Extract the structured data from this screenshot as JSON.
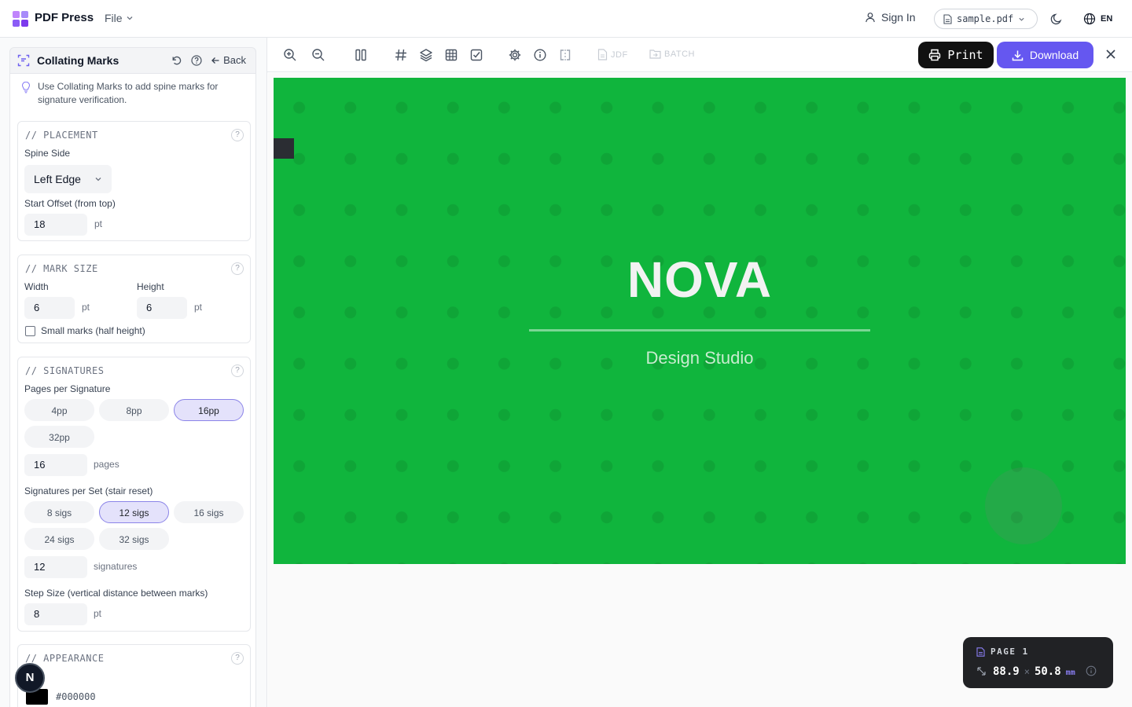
{
  "header": {
    "brand": "PDF Press",
    "file_menu": "File",
    "sign_in": "Sign In",
    "file_name": "sample.pdf",
    "language": "EN",
    "logo_colors": [
      "#a78bfa",
      "#7c3aed",
      "#c084fc",
      "#8b5cf6"
    ]
  },
  "panel": {
    "title": "Collating Marks",
    "back_label": "Back",
    "tip": "Use Collating Marks to add spine marks for signature verification."
  },
  "placement": {
    "section_title": "// PLACEMENT",
    "spine_side_label": "Spine Side",
    "spine_side_value": "Left Edge",
    "start_offset_label": "Start Offset (from top)",
    "start_offset_value": "18",
    "start_offset_unit": "pt"
  },
  "mark_size": {
    "section_title": "// MARK SIZE",
    "width_label": "Width",
    "width_value": "6",
    "width_unit": "pt",
    "height_label": "Height",
    "height_value": "6",
    "height_unit": "pt",
    "small_marks_label": "Small marks (half height)",
    "small_marks_checked": false
  },
  "signatures": {
    "section_title": "// SIGNATURES",
    "pages_per_signature_label": "Pages per Signature",
    "pages_options": [
      "4pp",
      "8pp",
      "16pp",
      "32pp"
    ],
    "pages_selected": "16pp",
    "pages_value": "16",
    "pages_unit": "pages",
    "sigs_per_set_label": "Signatures per Set (stair reset)",
    "sigs_options": [
      "8 sigs",
      "12 sigs",
      "16 sigs",
      "24 sigs",
      "32 sigs"
    ],
    "sigs_selected": "12 sigs",
    "sigs_value": "12",
    "sigs_unit": "signatures",
    "step_size_label": "Step Size (vertical distance between marks)",
    "step_size_value": "8",
    "step_size_unit": "pt"
  },
  "appearance": {
    "section_title": "// APPEARANCE",
    "color_value": "#000000"
  },
  "avatar": {
    "initial": "N"
  },
  "toolbar": {
    "jdf_label": "JDF",
    "batch_label": "BATCH",
    "print_label": "Print",
    "download_label": "Download"
  },
  "preview": {
    "title": "NOVA",
    "subtitle": "Design Studio",
    "background_color": "#10b53d",
    "mark_color": "#2b2d33"
  },
  "page_info": {
    "label": "PAGE 1",
    "width": "88.9",
    "separator": "×",
    "height": "50.8",
    "unit": "mm"
  }
}
